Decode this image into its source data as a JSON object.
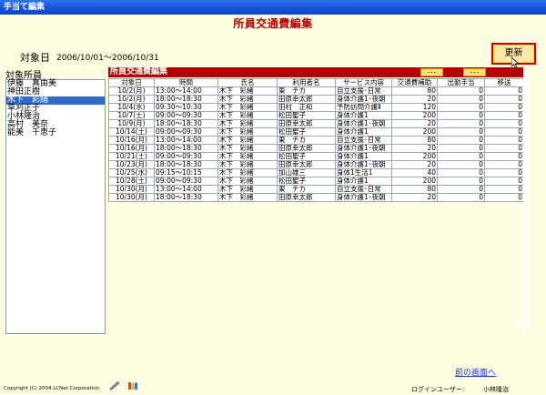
{
  "window": {
    "title": "手当て編集"
  },
  "page": {
    "title": "所員交通費編集"
  },
  "period": {
    "label": "対象日",
    "range": "2006/10/01～2006/10/31"
  },
  "toolbar": {
    "update_label": "更新"
  },
  "staff": {
    "label": "対象所員",
    "items": [
      {
        "name": "伊藤　真由美",
        "selected": false
      },
      {
        "name": "神田正樹",
        "selected": false
      },
      {
        "name": "木下　彩緒",
        "selected": true
      },
      {
        "name": "草刈正子",
        "selected": false
      },
      {
        "name": "小林隆治",
        "selected": false
      },
      {
        "name": "高村　美奈",
        "selected": false
      },
      {
        "name": "能美　千恵子",
        "selected": false
      }
    ]
  },
  "panel": {
    "title": "所員交通費編集",
    "ellipsis_label": "･･･",
    "columns": [
      "対象日",
      "時間",
      "氏名",
      "利用者名",
      "サービス内容",
      "交通費補助",
      "出勤手当",
      "移送"
    ],
    "rows": [
      [
        "10/2(月)",
        "13:00～14:00",
        "木下　彩緒",
        "東　チカ",
        "自立支援･日常",
        "80",
        "0",
        "0"
      ],
      [
        "10/2(月)",
        "18:00～18:30",
        "木下　彩緒",
        "田原幸太郎",
        "身体介護1･夜朝",
        "20",
        "0",
        "0"
      ],
      [
        "10/4(水)",
        "09:30～10:30",
        "木下　彩緒",
        "田村　正和",
        "予防訪問介護Ⅱ",
        "120",
        "0",
        "0"
      ],
      [
        "10/7(土)",
        "09:00～09:30",
        "木下　彩緒",
        "松田聖子",
        "身体介護1",
        "200",
        "0",
        "0"
      ],
      [
        "10/9(月)",
        "18:00～18:30",
        "木下　彩緒",
        "田原幸太郎",
        "身体介護1･夜朝",
        "20",
        "0",
        "0"
      ],
      [
        "10/14(土)",
        "09:00～09:30",
        "木下　彩緒",
        "松田聖子",
        "身体介護1",
        "200",
        "0",
        "0"
      ],
      [
        "10/16(月)",
        "13:00～14:00",
        "木下　彩緒",
        "東　チカ",
        "自立支援･日常",
        "80",
        "0",
        "0"
      ],
      [
        "10/16(月)",
        "18:00～18:30",
        "木下　彩緒",
        "田原幸太郎",
        "身体介護1･夜朝",
        "20",
        "0",
        "0"
      ],
      [
        "10/21(土)",
        "09:00～09:30",
        "木下　彩緒",
        "松田聖子",
        "身体介護1",
        "200",
        "0",
        "0"
      ],
      [
        "10/23(月)",
        "18:00～18:30",
        "木下　彩緒",
        "田原幸太郎",
        "身体介護1･夜朝",
        "20",
        "0",
        "0"
      ],
      [
        "10/25(水)",
        "09:15～10:15",
        "木下　彩緒",
        "加山雄三",
        "身体1生活1",
        "40",
        "0",
        "0"
      ],
      [
        "10/28(土)",
        "09:00～09:30",
        "木下　彩緒",
        "松田聖子",
        "身体介護1",
        "200",
        "0",
        "0"
      ],
      [
        "10/30(月)",
        "13:00～14:00",
        "木下　彩緒",
        "東　チカ",
        "自立支援･日常",
        "80",
        "0",
        "0"
      ],
      [
        "10/30(月)",
        "18:00～18:30",
        "木下　彩緒",
        "田原幸太郎",
        "身体介護1･夜朝",
        "20",
        "0",
        "0"
      ]
    ]
  },
  "footer": {
    "prev_link": "前の画面へ",
    "copyright": "Copyright (C) 2004 LCNet Corporation",
    "login_label": "ログインユーザー:",
    "login_name": "小林隆治"
  },
  "colors": {
    "accent": "#b00000",
    "titlebar": "#1452d6",
    "background": "#fffde1",
    "selection": "#316ac5"
  }
}
